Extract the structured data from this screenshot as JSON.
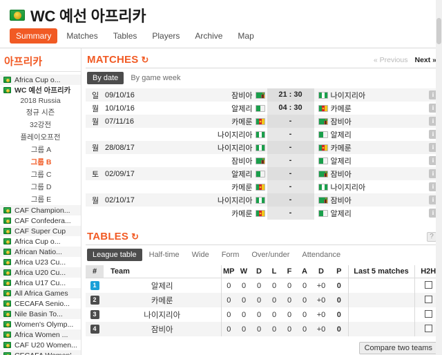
{
  "header": {
    "logo_icon": "africa-globe-icon",
    "title_prefix": "WC",
    "title_rest": "예선 아프리카",
    "accent_color": "#f15a24",
    "tabs": [
      {
        "label": "Summary",
        "active": true
      },
      {
        "label": "Matches",
        "active": false
      },
      {
        "label": "Tables",
        "active": false
      },
      {
        "label": "Players",
        "active": false
      },
      {
        "label": "Archive",
        "active": false
      },
      {
        "label": "Map",
        "active": false
      }
    ]
  },
  "sidebar": {
    "heading": "아프리카",
    "items": [
      {
        "type": "league",
        "label": "Africa Cup o...",
        "bold": false
      },
      {
        "type": "league",
        "label": "WC 예선 아프리카",
        "bold": true
      },
      {
        "type": "sub",
        "label": "2018 Russia",
        "level": 0,
        "selected": false
      },
      {
        "type": "sub",
        "label": "정규 시즌",
        "level": 1,
        "selected": false
      },
      {
        "type": "sub",
        "label": "32강전",
        "level": 1,
        "selected": false
      },
      {
        "type": "sub",
        "label": "플레이오프전",
        "level": 1,
        "selected": false
      },
      {
        "type": "sub",
        "label": "그룹 A",
        "level": 2,
        "selected": false
      },
      {
        "type": "sub",
        "label": "그룹 B",
        "level": 2,
        "selected": true
      },
      {
        "type": "sub",
        "label": "그룹 C",
        "level": 2,
        "selected": false
      },
      {
        "type": "sub",
        "label": "그룹 D",
        "level": 2,
        "selected": false
      },
      {
        "type": "sub",
        "label": "그룹 E",
        "level": 2,
        "selected": false
      },
      {
        "type": "league",
        "label": "CAF Champion...",
        "bold": false
      },
      {
        "type": "league",
        "label": "CAF Confedera...",
        "bold": false
      },
      {
        "type": "league",
        "label": "CAF Super Cup",
        "bold": false
      },
      {
        "type": "league",
        "label": "Africa Cup o...",
        "bold": false
      },
      {
        "type": "league",
        "label": "African Natio...",
        "bold": false
      },
      {
        "type": "league",
        "label": "Africa U23 Cu...",
        "bold": false
      },
      {
        "type": "league",
        "label": "Africa U20 Cu...",
        "bold": false
      },
      {
        "type": "league",
        "label": "Africa U17 Cu...",
        "bold": false
      },
      {
        "type": "league",
        "label": "All Africa Games",
        "bold": false
      },
      {
        "type": "league",
        "label": "CECAFA Senio...",
        "bold": false
      },
      {
        "type": "league",
        "label": "Nile Basin To...",
        "bold": false
      },
      {
        "type": "league",
        "label": "Women's Olymp...",
        "bold": false
      },
      {
        "type": "league",
        "label": "Africa Women ...",
        "bold": false
      },
      {
        "type": "league",
        "label": "CAF U20 Women...",
        "bold": false
      },
      {
        "type": "league",
        "label": "CECAFA Women'...",
        "bold": false
      }
    ]
  },
  "matches_section": {
    "title": "MATCHES",
    "refresh_icon": "refresh-icon",
    "prev_label": "« Previous",
    "next_label": "Next »",
    "subtabs": [
      {
        "label": "By date",
        "active": true
      },
      {
        "label": "By game week",
        "active": false
      }
    ],
    "rows": [
      {
        "day": "일",
        "date": "09/10/16",
        "home": "잠비아",
        "home_flag": "zambia",
        "score": "21 : 30",
        "away": "나이지리아",
        "away_flag": "nigeria",
        "info_icon": "info-icon"
      },
      {
        "day": "월",
        "date": "10/10/16",
        "home": "알제리",
        "home_flag": "algeria",
        "score": "04 : 30",
        "away": "카메룬",
        "away_flag": "cameroon",
        "info_icon": "info-icon"
      },
      {
        "day": "월",
        "date": "07/11/16",
        "home": "카메룬",
        "home_flag": "cameroon",
        "score": "-",
        "away": "잠비아",
        "away_flag": "zambia",
        "info_icon": "info-icon"
      },
      {
        "day": "",
        "date": "",
        "home": "나이지리아",
        "home_flag": "nigeria",
        "score": "-",
        "away": "알제리",
        "away_flag": "algeria",
        "info_icon": "info-icon"
      },
      {
        "day": "월",
        "date": "28/08/17",
        "home": "나이지리아",
        "home_flag": "nigeria",
        "score": "-",
        "away": "카메룬",
        "away_flag": "cameroon",
        "info_icon": "info-icon"
      },
      {
        "day": "",
        "date": "",
        "home": "잠비아",
        "home_flag": "zambia",
        "score": "-",
        "away": "알제리",
        "away_flag": "algeria",
        "info_icon": "info-icon"
      },
      {
        "day": "토",
        "date": "02/09/17",
        "home": "알제리",
        "home_flag": "algeria",
        "score": "-",
        "away": "잠비아",
        "away_flag": "zambia",
        "info_icon": "info-icon"
      },
      {
        "day": "",
        "date": "",
        "home": "카메룬",
        "home_flag": "cameroon",
        "score": "-",
        "away": "나이지리아",
        "away_flag": "nigeria",
        "info_icon": "info-icon"
      },
      {
        "day": "월",
        "date": "02/10/17",
        "home": "나이지리아",
        "home_flag": "nigeria",
        "score": "-",
        "away": "잠비아",
        "away_flag": "zambia",
        "info_icon": "info-icon"
      },
      {
        "day": "",
        "date": "",
        "home": "카메룬",
        "home_flag": "cameroon",
        "score": "-",
        "away": "알제리",
        "away_flag": "algeria",
        "info_icon": "info-icon"
      }
    ]
  },
  "tables_section": {
    "title": "TABLES",
    "refresh_icon": "refresh-icon",
    "help_icon": "question-mark-icon",
    "subtabs": [
      {
        "label": "League table",
        "active": true
      },
      {
        "label": "Half-time",
        "active": false
      },
      {
        "label": "Wide",
        "active": false
      },
      {
        "label": "Form",
        "active": false
      },
      {
        "label": "Over/under",
        "active": false
      },
      {
        "label": "Attendance",
        "active": false
      }
    ],
    "columns": [
      "#",
      "Team",
      "MP",
      "W",
      "D",
      "L",
      "F",
      "A",
      "D",
      "P",
      "Last 5 matches",
      "H2H"
    ],
    "rows": [
      {
        "rank": "1",
        "team": "알제리",
        "mp": "0",
        "w": "0",
        "d": "0",
        "l": "0",
        "f": "0",
        "a": "0",
        "gd": "+0",
        "p": "0",
        "last5": "",
        "h2h_checkbox": "unchecked"
      },
      {
        "rank": "2",
        "team": "카메룬",
        "mp": "0",
        "w": "0",
        "d": "0",
        "l": "0",
        "f": "0",
        "a": "0",
        "gd": "+0",
        "p": "0",
        "last5": "",
        "h2h_checkbox": "unchecked"
      },
      {
        "rank": "3",
        "team": "나이지리아",
        "mp": "0",
        "w": "0",
        "d": "0",
        "l": "0",
        "f": "0",
        "a": "0",
        "gd": "+0",
        "p": "0",
        "last5": "",
        "h2h_checkbox": "unchecked"
      },
      {
        "rank": "4",
        "team": "잠비아",
        "mp": "0",
        "w": "0",
        "d": "0",
        "l": "0",
        "f": "0",
        "a": "0",
        "gd": "+0",
        "p": "0",
        "last5": "",
        "h2h_checkbox": "unchecked"
      }
    ],
    "compare_button": "Compare two teams"
  }
}
